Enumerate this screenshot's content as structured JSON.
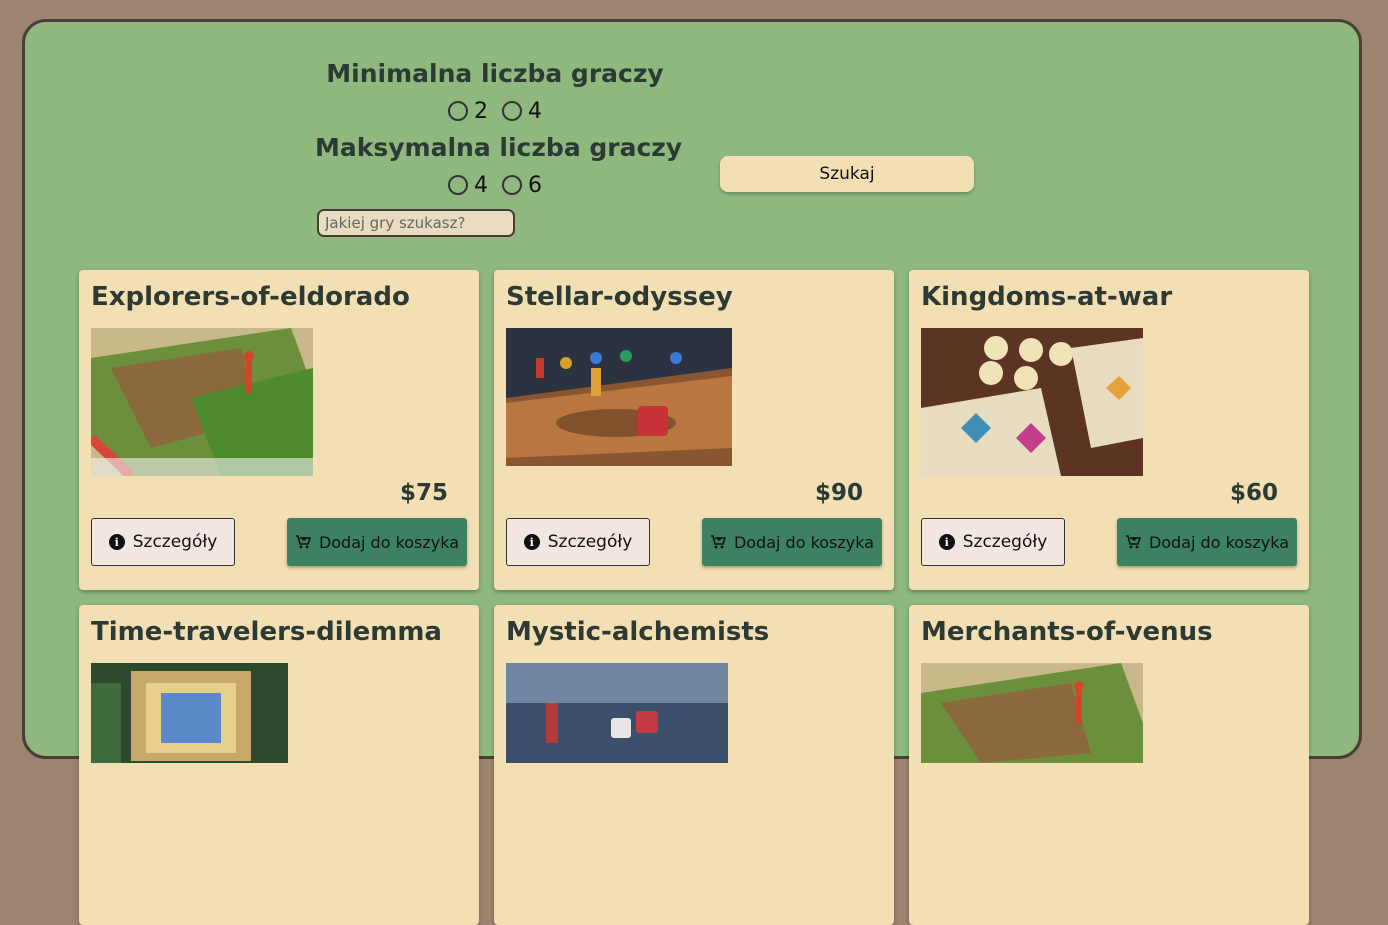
{
  "filters": {
    "min_players": {
      "label": "Minimalna liczba graczy",
      "options": [
        "2",
        "4"
      ]
    },
    "max_players": {
      "label": "Maksymalna liczba graczy",
      "options": [
        "4",
        "6"
      ]
    },
    "search_placeholder": "Jakiej gry szukasz?",
    "search_button_label": "Szukaj"
  },
  "product_buttons": {
    "details_label": "Szczegóły",
    "cart_label": "Dodaj do koszyka"
  },
  "products": [
    {
      "name": "Explorers-of-eldorado",
      "price": "$75"
    },
    {
      "name": "Stellar-odyssey",
      "price": "$90"
    },
    {
      "name": "Kingdoms-at-war",
      "price": "$60"
    },
    {
      "name": "Time-travelers-dilemma",
      "price": ""
    },
    {
      "name": "Mystic-alchemists",
      "price": ""
    },
    {
      "name": "Merchants-of-venus",
      "price": ""
    }
  ],
  "colors": {
    "background": "#9d8470",
    "panel": "#8fb87f",
    "card": "#f3dfb4",
    "cart_button": "#3c8162"
  }
}
